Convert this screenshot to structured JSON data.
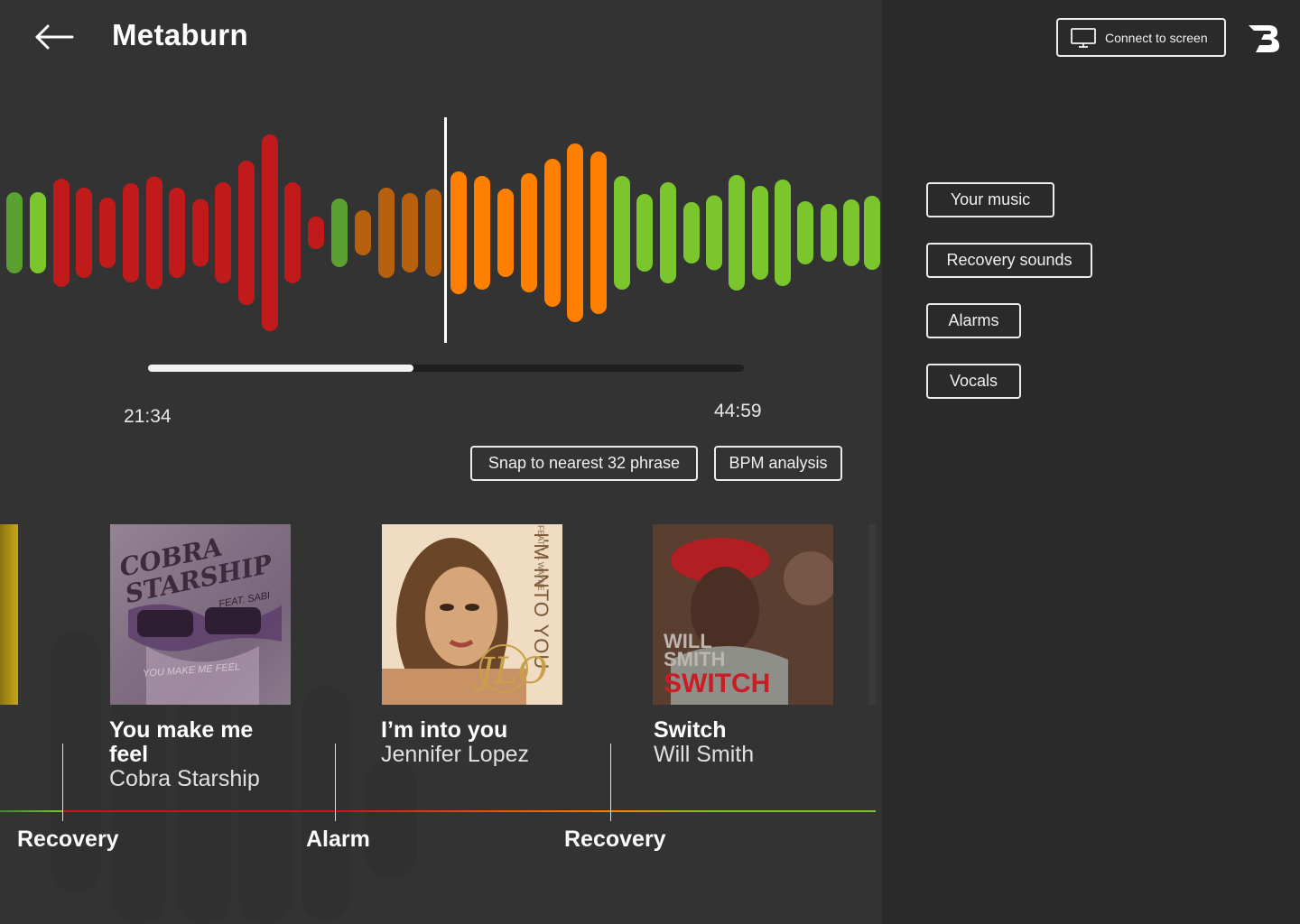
{
  "header": {
    "title": "Metaburn",
    "connect_label": "Connect to screen"
  },
  "player": {
    "current_time": "21:34",
    "total_time": "44:59",
    "progress": 0.445
  },
  "actions": {
    "snap_label": "Snap to nearest 32 phrase",
    "bpm_label": "BPM analysis"
  },
  "categories": [
    {
      "label": "Your music"
    },
    {
      "label": "Recovery sounds"
    },
    {
      "label": "Alarms"
    },
    {
      "label": "Vocals"
    }
  ],
  "tracks": [
    {
      "title": "You make me feel",
      "artist": "Cobra Starship",
      "cover_text": "COBRA STARSHIP",
      "cover_sub": "FEAT. SABI",
      "cover_bottom": "YOU MAKE ME FEEL"
    },
    {
      "title": "I’m into you",
      "artist": "Jennifer Lopez",
      "cover_text": "I'M INTO YOU",
      "cover_sub": "FEAT. LIL WAYNE",
      "cover_bottom": "JLO"
    },
    {
      "title": "Switch",
      "artist": "Will Smith",
      "cover_text": "WILL SMITH",
      "cover_sub": "SWITCH",
      "cover_bottom": ""
    }
  ],
  "timeline": {
    "labels": [
      "Recovery",
      "Alarm",
      "Recovery"
    ]
  },
  "colors": {
    "green": "#7bc62d",
    "dark_green": "#5aa132",
    "red": "#c01a1a",
    "brown": "#b7600e",
    "orange": "#ff7f00",
    "accent_purple": "#b66ddc",
    "accent_cyan": "#67dbdd"
  },
  "icons": {
    "back": "arrow-left-icon",
    "monitor": "monitor-icon",
    "logo": "brand-logo"
  }
}
